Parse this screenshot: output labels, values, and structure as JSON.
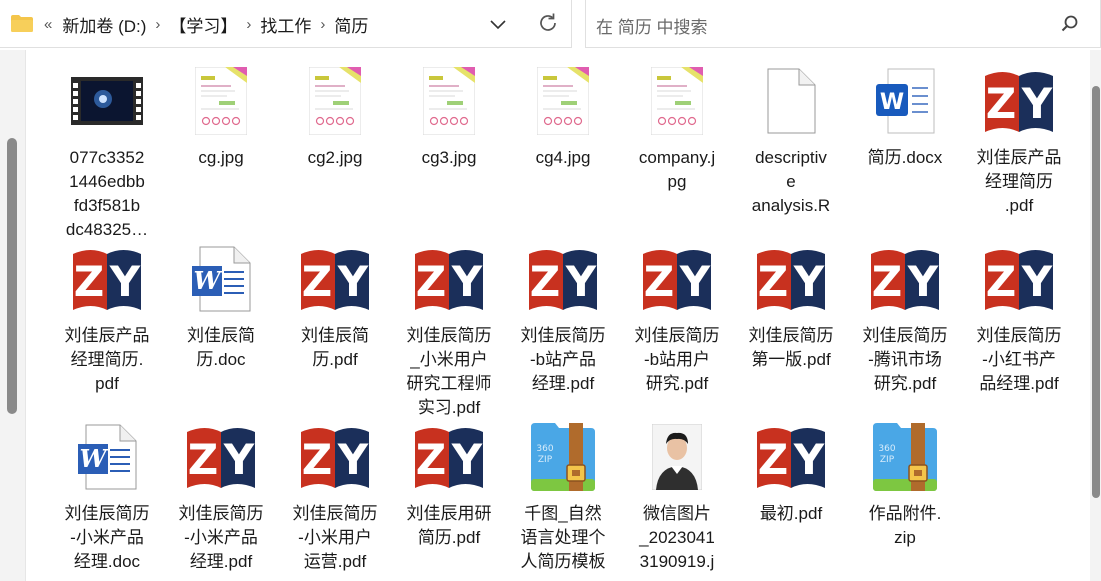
{
  "address_bar": {
    "collapse_glyph": "«",
    "breadcrumbs": [
      {
        "label": "新加卷 (D:)"
      },
      {
        "label": "【学习】"
      },
      {
        "label": "找工作"
      },
      {
        "label": "简历"
      }
    ],
    "separator": "›"
  },
  "search": {
    "placeholder": "在 简历 中搜索"
  },
  "files": [
    {
      "name": "077c3352\n1446edbb\nfd3f581b\ndc48325…",
      "type": "video"
    },
    {
      "name": "cg.jpg",
      "type": "resume-image"
    },
    {
      "name": "cg2.jpg",
      "type": "resume-image"
    },
    {
      "name": "cg3.jpg",
      "type": "resume-image"
    },
    {
      "name": "cg4.jpg",
      "type": "resume-image"
    },
    {
      "name": "company.j\npg",
      "type": "resume-image"
    },
    {
      "name": "descriptiv\ne\nanalysis.R",
      "type": "blank"
    },
    {
      "name": "简历.docx",
      "type": "docx"
    },
    {
      "name": "刘佳辰产品\n经理简历\n.pdf",
      "type": "pdf"
    },
    {
      "name": "刘佳辰产品\n经理简历.\npdf",
      "type": "pdf"
    },
    {
      "name": "刘佳辰简\n历.doc",
      "type": "doc"
    },
    {
      "name": "刘佳辰简\n历.pdf",
      "type": "pdf"
    },
    {
      "name": "刘佳辰简历\n_小米用户\n研究工程师\n实习.pdf",
      "type": "pdf"
    },
    {
      "name": "刘佳辰简历\n-b站产品\n经理.pdf",
      "type": "pdf"
    },
    {
      "name": "刘佳辰简历\n-b站用户\n研究.pdf",
      "type": "pdf"
    },
    {
      "name": "刘佳辰简历\n第一版.pdf",
      "type": "pdf"
    },
    {
      "name": "刘佳辰简历\n-腾讯市场\n研究.pdf",
      "type": "pdf"
    },
    {
      "name": "刘佳辰简历\n-小红书产\n品经理.pdf",
      "type": "pdf"
    },
    {
      "name": "刘佳辰简历\n-小米产品\n经理.doc",
      "type": "doc"
    },
    {
      "name": "刘佳辰简历\n-小米产品\n经理.pdf",
      "type": "pdf"
    },
    {
      "name": "刘佳辰简历\n-小米用户\n运营.pdf",
      "type": "pdf"
    },
    {
      "name": "刘佳辰用研\n简历.pdf",
      "type": "pdf"
    },
    {
      "name": "千图_自然\n语言处理个\n人简历模板",
      "type": "zip"
    },
    {
      "name": "微信图片\n_2023041\n3190919.j",
      "type": "photo"
    },
    {
      "name": "最初.pdf",
      "type": "pdf"
    },
    {
      "name": "作品附件.\nzip",
      "type": "zip"
    }
  ],
  "icon_text": {
    "pdf_glyph_z": "Z",
    "pdf_glyph_y": "Y",
    "word_glyph": "W",
    "zip_brand": "360",
    "zip_ext": "ZIP"
  },
  "colors": {
    "pdf_red": "#c8311f",
    "pdf_navy": "#1b2f5a",
    "word_blue": "#2b5eb6",
    "zip_blue": "#4aa7e6",
    "zip_strap": "#b06b2c",
    "folder_yellow": "#f4c54a"
  },
  "icons": {
    "folder": "folder-icon",
    "chevron": "chevron-down-icon",
    "refresh": "refresh-icon",
    "search": "search-icon"
  }
}
